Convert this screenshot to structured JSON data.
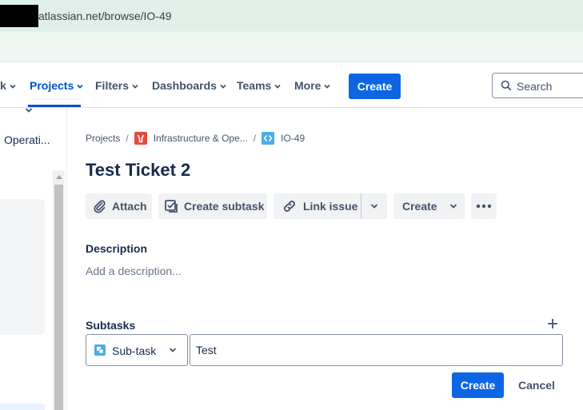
{
  "browser": {
    "url": "atlassian.net/browse/IO-49"
  },
  "nav": {
    "truncated_label": "k",
    "items": [
      {
        "label": "Projects",
        "active": true
      },
      {
        "label": "Filters"
      },
      {
        "label": "Dashboards"
      },
      {
        "label": "Teams"
      },
      {
        "label": "More"
      }
    ],
    "create_label": "Create",
    "search_placeholder": "Search"
  },
  "sidebar": {
    "project_name": "Operati..."
  },
  "breadcrumb": {
    "projects": "Projects",
    "project": "Infrastructure & Ope...",
    "issue_key": "IO-49"
  },
  "issue": {
    "title": "Test Ticket 2"
  },
  "actions": {
    "attach": "Attach",
    "create_subtask": "Create subtask",
    "link_issue": "Link issue",
    "create": "Create"
  },
  "description": {
    "heading": "Description",
    "placeholder": "Add a description..."
  },
  "subtasks": {
    "heading": "Subtasks",
    "type_label": "Sub-task",
    "input_value": "Test",
    "create_label": "Create",
    "cancel_label": "Cancel"
  },
  "colors": {
    "brand_blue": "#0c66e4",
    "nav_active": "#0052cc",
    "text_primary": "#172b4d",
    "text_subtle": "#42526e"
  }
}
